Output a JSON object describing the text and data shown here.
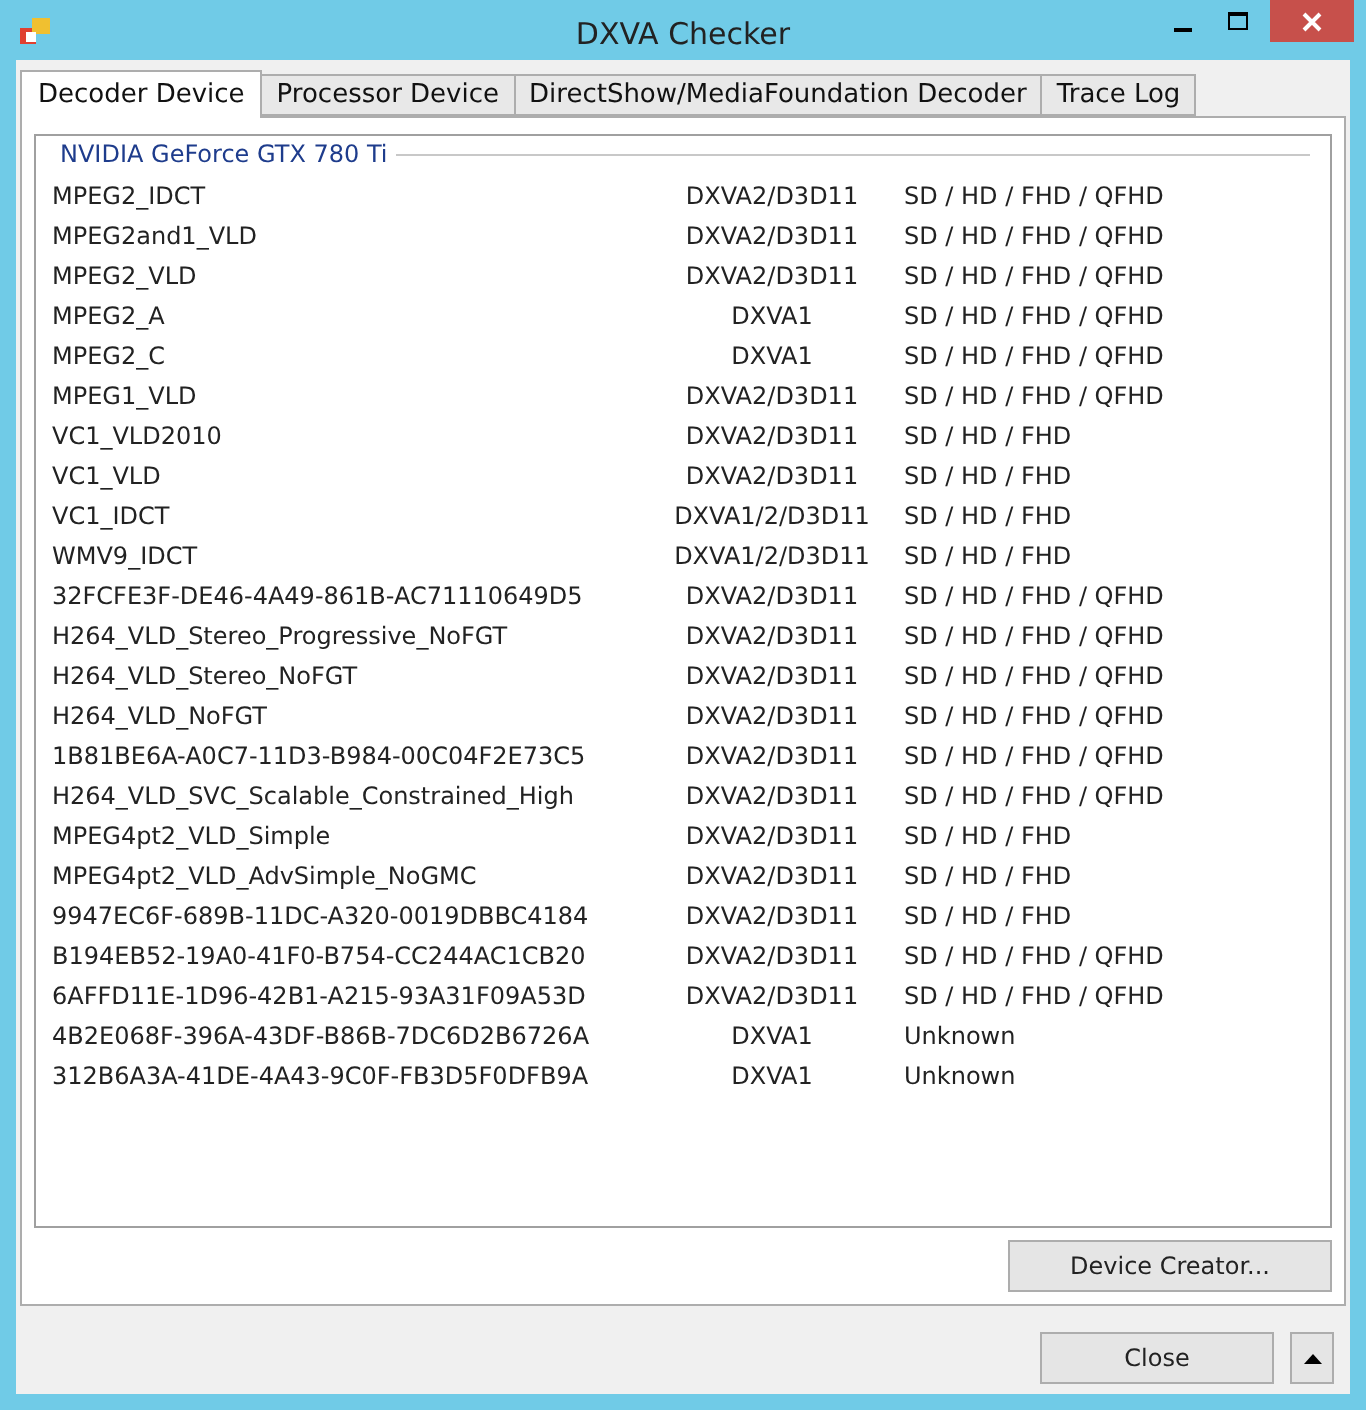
{
  "window": {
    "title": "DXVA Checker"
  },
  "tabs": [
    {
      "label": "Decoder Device",
      "selected": true
    },
    {
      "label": "Processor Device",
      "selected": false
    },
    {
      "label": "DirectShow/MediaFoundation Decoder",
      "selected": false
    },
    {
      "label": "Trace Log",
      "selected": false
    }
  ],
  "group": {
    "title": "NVIDIA GeForce GTX 780 Ti"
  },
  "decoders": [
    {
      "name": "MPEG2_IDCT",
      "api": "DXVA2/D3D11",
      "resolutions": "SD / HD / FHD / QFHD"
    },
    {
      "name": "MPEG2and1_VLD",
      "api": "DXVA2/D3D11",
      "resolutions": "SD / HD / FHD / QFHD"
    },
    {
      "name": "MPEG2_VLD",
      "api": "DXVA2/D3D11",
      "resolutions": "SD / HD / FHD / QFHD"
    },
    {
      "name": "MPEG2_A",
      "api": "DXVA1",
      "resolutions": "SD / HD / FHD / QFHD"
    },
    {
      "name": "MPEG2_C",
      "api": "DXVA1",
      "resolutions": "SD / HD / FHD / QFHD"
    },
    {
      "name": "MPEG1_VLD",
      "api": "DXVA2/D3D11",
      "resolutions": "SD / HD / FHD / QFHD"
    },
    {
      "name": "VC1_VLD2010",
      "api": "DXVA2/D3D11",
      "resolutions": "SD / HD / FHD"
    },
    {
      "name": "VC1_VLD",
      "api": "DXVA2/D3D11",
      "resolutions": "SD / HD / FHD"
    },
    {
      "name": "VC1_IDCT",
      "api": "DXVA1/2/D3D11",
      "resolutions": "SD / HD / FHD"
    },
    {
      "name": "WMV9_IDCT",
      "api": "DXVA1/2/D3D11",
      "resolutions": "SD / HD / FHD"
    },
    {
      "name": "32FCFE3F-DE46-4A49-861B-AC71110649D5",
      "api": "DXVA2/D3D11",
      "resolutions": "SD / HD / FHD / QFHD"
    },
    {
      "name": "H264_VLD_Stereo_Progressive_NoFGT",
      "api": "DXVA2/D3D11",
      "resolutions": "SD / HD / FHD / QFHD"
    },
    {
      "name": "H264_VLD_Stereo_NoFGT",
      "api": "DXVA2/D3D11",
      "resolutions": "SD / HD / FHD / QFHD"
    },
    {
      "name": "H264_VLD_NoFGT",
      "api": "DXVA2/D3D11",
      "resolutions": "SD / HD / FHD / QFHD"
    },
    {
      "name": "1B81BE6A-A0C7-11D3-B984-00C04F2E73C5",
      "api": "DXVA2/D3D11",
      "resolutions": "SD / HD / FHD / QFHD"
    },
    {
      "name": "H264_VLD_SVC_Scalable_Constrained_High",
      "api": "DXVA2/D3D11",
      "resolutions": "SD / HD / FHD / QFHD"
    },
    {
      "name": "MPEG4pt2_VLD_Simple",
      "api": "DXVA2/D3D11",
      "resolutions": "SD / HD / FHD"
    },
    {
      "name": "MPEG4pt2_VLD_AdvSimple_NoGMC",
      "api": "DXVA2/D3D11",
      "resolutions": "SD / HD / FHD"
    },
    {
      "name": "9947EC6F-689B-11DC-A320-0019DBBC4184",
      "api": "DXVA2/D3D11",
      "resolutions": "SD / HD / FHD"
    },
    {
      "name": "B194EB52-19A0-41F0-B754-CC244AC1CB20",
      "api": "DXVA2/D3D11",
      "resolutions": "SD / HD / FHD / QFHD"
    },
    {
      "name": "6AFFD11E-1D96-42B1-A215-93A31F09A53D",
      "api": "DXVA2/D3D11",
      "resolutions": "SD / HD / FHD / QFHD"
    },
    {
      "name": "4B2E068F-396A-43DF-B86B-7DC6D2B6726A",
      "api": "DXVA1",
      "resolutions": "Unknown"
    },
    {
      "name": "312B6A3A-41DE-4A43-9C0F-FB3D5F0DFB9A",
      "api": "DXVA1",
      "resolutions": "Unknown"
    }
  ],
  "buttons": {
    "device_creator": "Device Creator...",
    "close": "Close"
  }
}
